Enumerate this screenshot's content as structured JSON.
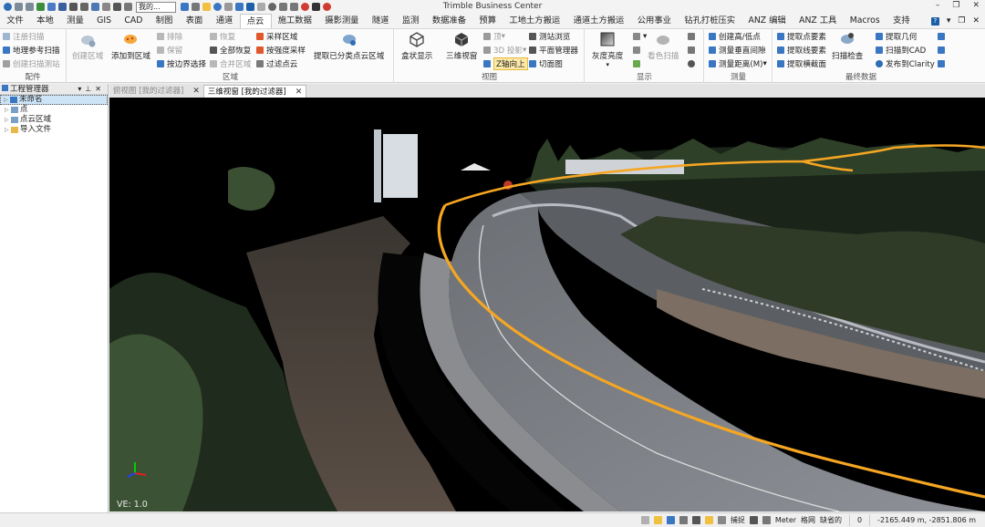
{
  "app": {
    "title": "Trimble Business Center",
    "qat_combo": "我的..."
  },
  "tabs": [
    "文件",
    "本地",
    "测量",
    "GIS",
    "CAD",
    "制图",
    "表面",
    "通道",
    "点云",
    "施工数据",
    "摄影测量",
    "隧道",
    "监测",
    "数据准备",
    "预算",
    "工地土方搬运",
    "通道土方搬运",
    "公用事业",
    "钻孔打桩压实",
    "ANZ 编辑",
    "ANZ 工具",
    "Macros",
    "支持"
  ],
  "active_tab": "点云",
  "help": "?",
  "ribbon": {
    "g1": {
      "label": "配件",
      "items": [
        "注册扫描",
        "地理参考扫描",
        "创建扫描测站"
      ]
    },
    "g2": {
      "label": "区域",
      "big": [
        "创建区域",
        "添加到区域"
      ],
      "col1": [
        "排除",
        "保留",
        "按边界选择"
      ],
      "col2": [
        "恢复",
        "全部恢复",
        "合并区域"
      ],
      "col3": [
        "采样区域",
        "按强度采样",
        "过滤点云"
      ],
      "big2": "提取已分类点云区域"
    },
    "g3": {
      "label": "视图",
      "big": [
        "盒状显示",
        "三维视窗"
      ],
      "col1": [
        "顶",
        "3D 投影",
        "Z轴向上"
      ],
      "col2": [
        "测站浏览",
        "平面管理器",
        "切面图"
      ]
    },
    "g4": {
      "label": "显示",
      "big": [
        "灰度亮度",
        "看色扫描"
      ]
    },
    "g5": {
      "label": "测量",
      "items": [
        "创建高/低点",
        "测量垂直间隙",
        "测量距离(M)"
      ]
    },
    "g6": {
      "label": "最终数据",
      "col1": [
        "提取点要素",
        "提取线要素",
        "提取横截面"
      ],
      "big": "扫描检查",
      "col2": [
        "提取几何",
        "扫描到CAD",
        "发布到Clarity"
      ]
    }
  },
  "left_panel": {
    "title": "工程管理器",
    "tree": [
      {
        "label": "未命名",
        "level": 0,
        "selected": true
      },
      {
        "label": "点",
        "level": 1
      },
      {
        "label": "点云区域",
        "level": 1
      },
      {
        "label": "导入文件",
        "level": 1
      }
    ]
  },
  "doc_tabs": [
    {
      "label": "俯视图 [我的过滤器]",
      "active": false
    },
    {
      "label": "三维视窗 [我的过滤器]",
      "active": true
    }
  ],
  "viewport": {
    "ve": "VE: 1.0",
    "alignment_color": "#f5a623"
  },
  "status": {
    "snap": "捕捉",
    "unit": "Meter",
    "grid": "格网",
    "default": "缺省的",
    "value": "0",
    "coords": "-2165.449 m, -2851.806 m"
  }
}
